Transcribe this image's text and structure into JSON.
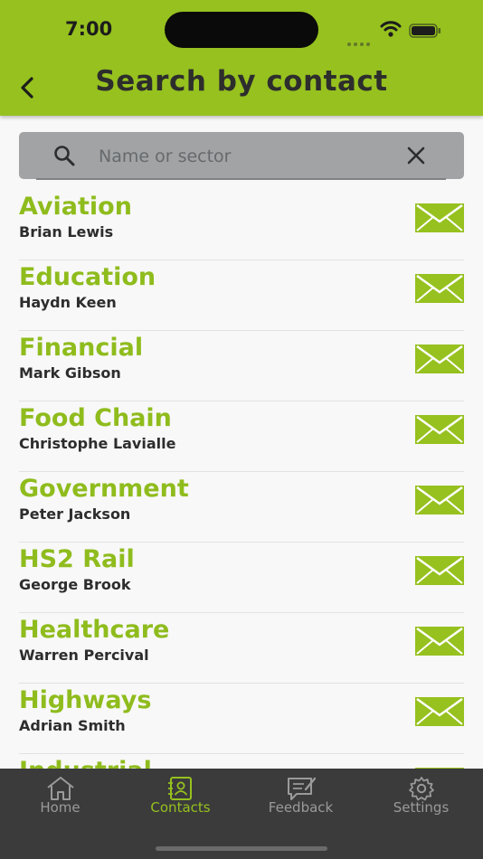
{
  "status": {
    "time": "7:00"
  },
  "header": {
    "title": "Search by contact",
    "back_icon": "chevron-left-icon"
  },
  "search": {
    "placeholder": "Name or sector",
    "value": ""
  },
  "contacts": [
    {
      "sector": "Aviation",
      "name": "Brian Lewis"
    },
    {
      "sector": "Education",
      "name": "Haydn Keen"
    },
    {
      "sector": "Financial",
      "name": "Mark Gibson"
    },
    {
      "sector": "Food Chain",
      "name": "Christophe Lavialle"
    },
    {
      "sector": "Government",
      "name": "Peter Jackson"
    },
    {
      "sector": "HS2 Rail",
      "name": "George Brook"
    },
    {
      "sector": "Healthcare",
      "name": "Warren Percival"
    },
    {
      "sector": "Highways",
      "name": "Adrian Smith"
    },
    {
      "sector": "Industrial",
      "name": ""
    }
  ],
  "tabs": [
    {
      "label": "Home",
      "icon": "home-icon",
      "active": false
    },
    {
      "label": "Contacts",
      "icon": "contacts-icon",
      "active": true
    },
    {
      "label": "Feedback",
      "icon": "feedback-icon",
      "active": false
    },
    {
      "label": "Settings",
      "icon": "gear-icon",
      "active": false
    }
  ],
  "colors": {
    "accent": "#96c11f",
    "tabbar": "#3b3b3b",
    "search_bg": "#a1a3a5"
  }
}
